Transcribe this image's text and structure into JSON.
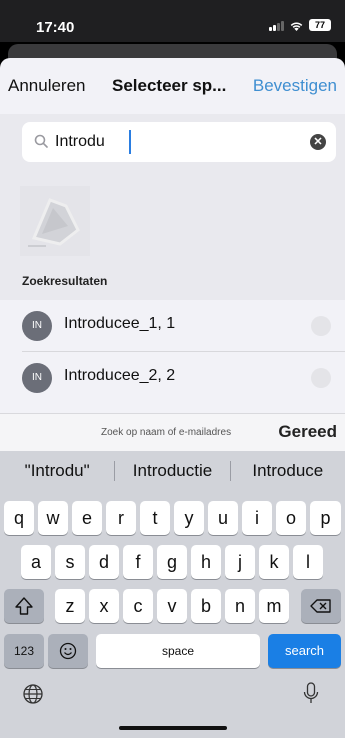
{
  "status": {
    "time": "17:40",
    "battery": "77"
  },
  "nav": {
    "cancel": "Annuleren",
    "title": "Selecteer sp...",
    "confirm": "Bevestigen"
  },
  "search": {
    "value": "Introdu",
    "icon": "search-icon",
    "clear_icon": "clear-icon"
  },
  "section": {
    "results_label": "Zoekresultaten"
  },
  "results": [
    {
      "initials": "IN",
      "name": "Introducee_1, 1"
    },
    {
      "initials": "IN",
      "name": "Introducee_2, 2"
    }
  ],
  "accessory": {
    "hint": "Zoek op naam of e-mailadres",
    "done": "Gereed"
  },
  "keyboard": {
    "suggestions": [
      "\"Introdu\"",
      "Introductie",
      "Introduce"
    ],
    "row1": [
      "q",
      "w",
      "e",
      "r",
      "t",
      "y",
      "u",
      "i",
      "o",
      "p"
    ],
    "row2": [
      "a",
      "s",
      "d",
      "f",
      "g",
      "h",
      "j",
      "k",
      "l"
    ],
    "row3": [
      "z",
      "x",
      "c",
      "v",
      "b",
      "n",
      "m"
    ],
    "numbers_label": "123",
    "space_label": "space",
    "search_label": "search"
  },
  "colors": {
    "accent": "#3f8fd1",
    "search_key": "#1a7fe5",
    "avatar": "#6b6e78"
  }
}
